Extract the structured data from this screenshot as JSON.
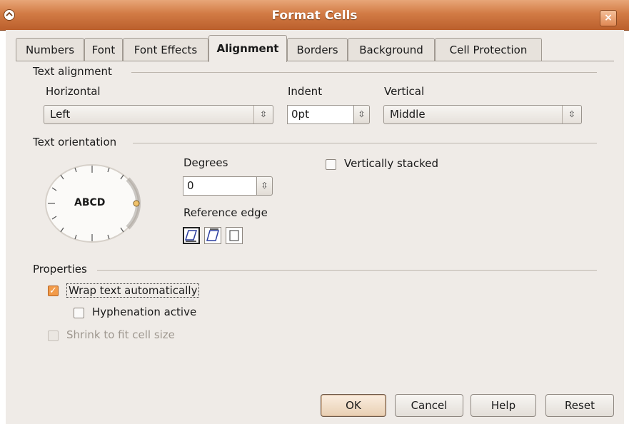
{
  "window": {
    "title": "Format Cells",
    "close_glyph": "×"
  },
  "tabs": [
    {
      "label": "Numbers"
    },
    {
      "label": "Font"
    },
    {
      "label": "Font Effects"
    },
    {
      "label": "Alignment",
      "active": true
    },
    {
      "label": "Borders"
    },
    {
      "label": "Background"
    },
    {
      "label": "Cell Protection"
    }
  ],
  "text_alignment": {
    "header": "Text alignment",
    "horizontal_label": "Horizontal",
    "horizontal_value": "Left",
    "indent_label": "Indent",
    "indent_value": "0pt",
    "vertical_label": "Vertical",
    "vertical_value": "Middle"
  },
  "text_orientation": {
    "header": "Text orientation",
    "dial_text": "ABCD",
    "degrees_label": "Degrees",
    "degrees_value": "0",
    "reference_edge_label": "Reference edge",
    "vertically_stacked_label": "Vertically stacked",
    "vertically_stacked_checked": false
  },
  "properties": {
    "header": "Properties",
    "wrap_label": "Wrap text automatically",
    "wrap_checked": true,
    "hyphenation_label": "Hyphenation active",
    "hyphenation_checked": false,
    "shrink_label": "Shrink to fit cell size",
    "shrink_checked": false,
    "shrink_disabled": true
  },
  "buttons": {
    "ok": "OK",
    "cancel": "Cancel",
    "help": "Help",
    "reset": "Reset"
  },
  "icons": {
    "menu": "window-menu-icon",
    "close": "close-icon",
    "combo": "combo-arrow-icon",
    "spin": "spin-arrows-icon",
    "check": "checkmark-icon"
  },
  "colors": {
    "titlebar": "#d27b45",
    "accent": "#f29b4a",
    "dialog_bg": "#efebe7"
  }
}
